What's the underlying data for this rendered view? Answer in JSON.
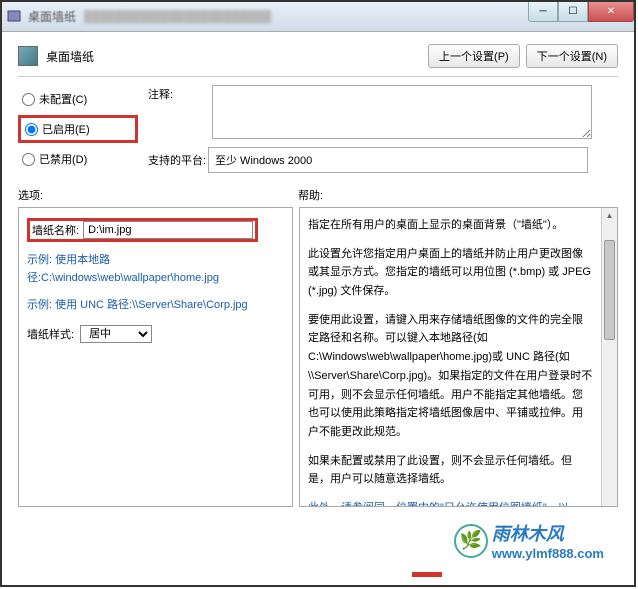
{
  "titlebar": {
    "icon_name": "app-icon",
    "title": "桌面墙纸"
  },
  "header": {
    "title": "桌面墙纸",
    "prev_btn": "上一个设置(P)",
    "next_btn": "下一个设置(N)"
  },
  "config": {
    "not_configured": "未配置(C)",
    "enabled": "已启用(E)",
    "disabled": "已禁用(D)",
    "notes_label": "注释:",
    "platform_label": "支持的平台:",
    "platform_value": "至少 Windows 2000"
  },
  "sections": {
    "options": "选项:",
    "help": "帮助:"
  },
  "options": {
    "name_label": "墙纸名称:",
    "name_value": "D:\\im.jpg",
    "example1": "示例: 使用本地路径:C:\\windows\\web\\wallpaper\\home.jpg",
    "example2": "示例: 使用 UNC 路径:\\\\Server\\Share\\Corp.jpg",
    "style_label": "墙纸样式:",
    "style_value": "居中"
  },
  "help": {
    "p1": "指定在所有用户的桌面上显示的桌面背景（\"墙纸\"）。",
    "p2": "此设置允许您指定用户桌面上的墙纸并防止用户更改图像或其显示方式。您指定的墙纸可以用位图 (*.bmp) 或 JPEG (*.jpg) 文件保存。",
    "p3": "要使用此设置，请键入用来存储墙纸图像的文件的完全限定路径和名称。可以键入本地路径(如 C:\\Windows\\web\\wallpaper\\home.jpg)或 UNC 路径(如 \\\\Server\\Share\\Corp.jpg)。如果指定的文件在用户登录时不可用，则不会显示任何墙纸。用户不能指定其他墙纸。您也可以使用此策略指定将墙纸图像居中、平铺或拉伸。用户不能更改此规范。",
    "p4": "如果未配置或禁用了此设置，则不会显示任何墙纸。但是，用户可以随意选择墙纸。",
    "p5": "此外，请参阅同一位置中的\"只允许使用位图墙纸\"，以及\"用户配置\\管理模板\\控制面板\"中的\"阻止更改墙纸\"设置"
  },
  "watermark": {
    "cn": "雨林木风",
    "url": "www.ylmf888.com"
  }
}
